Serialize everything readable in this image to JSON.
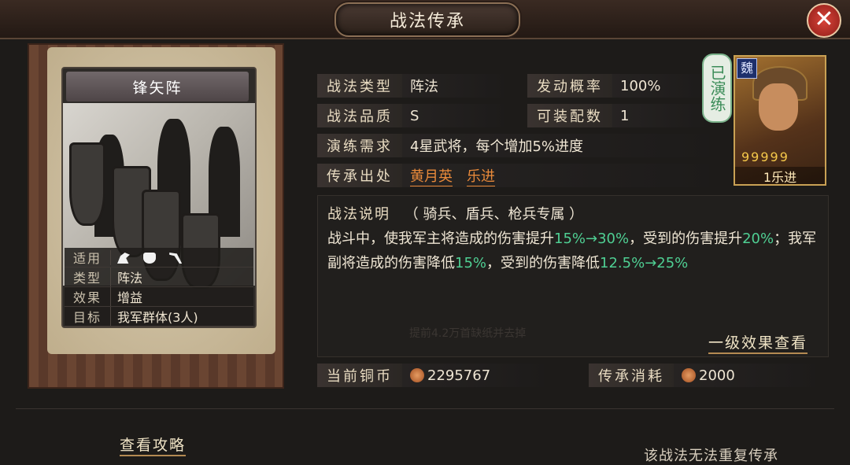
{
  "header": {
    "title": "战法传承",
    "close_label": "✕"
  },
  "card": {
    "name": "锋矢阵",
    "attributes": [
      {
        "key": "适用",
        "value": ""
      },
      {
        "key": "类型",
        "value": "阵法"
      },
      {
        "key": "效果",
        "value": "增益"
      },
      {
        "key": "目标",
        "value": "我军群体(3人)"
      }
    ],
    "unit_icons": [
      "horse-icon",
      "shield-icon",
      "spear-icon"
    ]
  },
  "info": {
    "type_label": "战法类型",
    "type_value": "阵法",
    "prob_label": "发动概率",
    "prob_value": "100%",
    "quality_label": "战法品质",
    "quality_value": "S",
    "equip_label": "可装配数",
    "equip_value": "1",
    "train_label": "演练需求",
    "train_value": "4星武将，每个增加5%进度",
    "source_label": "传承出处",
    "sources": [
      "黄月英",
      "乐进"
    ]
  },
  "badge": "已演练",
  "portrait": {
    "faction": "魏",
    "stars": "99999",
    "name": "1乐进"
  },
  "description": {
    "label": "战法说明",
    "restriction": "（ 骑兵、盾兵、枪兵专属 ）",
    "p1": "战斗中，使我军主将造成的伤害提升",
    "g1": "15%→30%",
    "p2": "，受到的伤害提升",
    "g2": "20%",
    "p3": "；我军副将造成的伤害降低",
    "g3": "15%",
    "p4": "，受到的伤害降低",
    "g4": "12.5%→25%"
  },
  "faded_text": "提前4.2万首缺纸并去掉",
  "effect_link": "一级效果查看",
  "currency": {
    "current_label": "当前铜币",
    "current_value": "2295767",
    "cost_label": "传承消耗",
    "cost_value": "2000"
  },
  "footer": {
    "strategy_link": "查看攻略",
    "notice": "该战法无法重复传承"
  },
  "colors": {
    "highlight_green": "#4fcf93",
    "link_orange": "#e98a3a",
    "close_red": "#c9342b"
  }
}
